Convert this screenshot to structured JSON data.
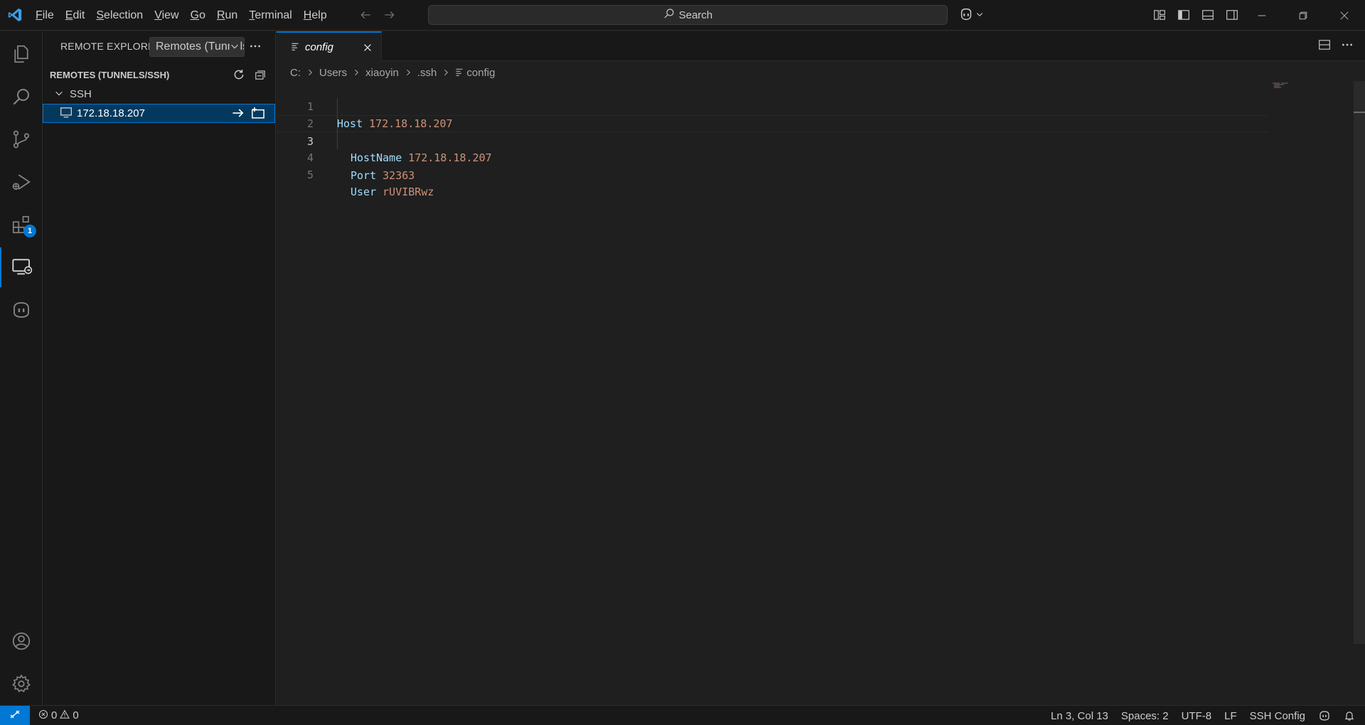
{
  "titlebar": {
    "menu": [
      "File",
      "Edit",
      "Selection",
      "View",
      "Go",
      "Run",
      "Terminal",
      "Help"
    ],
    "search_label": "Search"
  },
  "activity": {
    "extensions_badge": "1"
  },
  "sidebar": {
    "title": "REMOTE EXPLORER",
    "select_value": "Remotes (Tunnels/SSH)",
    "section_title": "REMOTES (TUNNELS/SSH)",
    "group_label": "SSH",
    "host_label": "172.18.18.207"
  },
  "editor": {
    "tab_label": "config",
    "breadcrumbs": [
      "C:",
      "Users",
      "xiaoyin",
      ".ssh",
      "config"
    ],
    "lines": [
      {
        "num": "1",
        "key": "Host",
        "value": "172.18.18.207"
      },
      {
        "num": "2",
        "key": "HostName",
        "value": "172.18.18.207"
      },
      {
        "num": "3",
        "key": "Port",
        "value": "32363"
      },
      {
        "num": "4",
        "key": "User",
        "value": "rUVIBRwz"
      },
      {
        "num": "5",
        "key": "",
        "value": ""
      }
    ]
  },
  "statusbar": {
    "errors": "0",
    "warnings": "0",
    "cursor": "Ln 3, Col 13",
    "spaces": "Spaces: 2",
    "encoding": "UTF-8",
    "eol": "LF",
    "language": "SSH Config"
  },
  "colors": {
    "accent": "#0078d4",
    "keyword": "#9cdcfe",
    "value": "#ce9178"
  }
}
